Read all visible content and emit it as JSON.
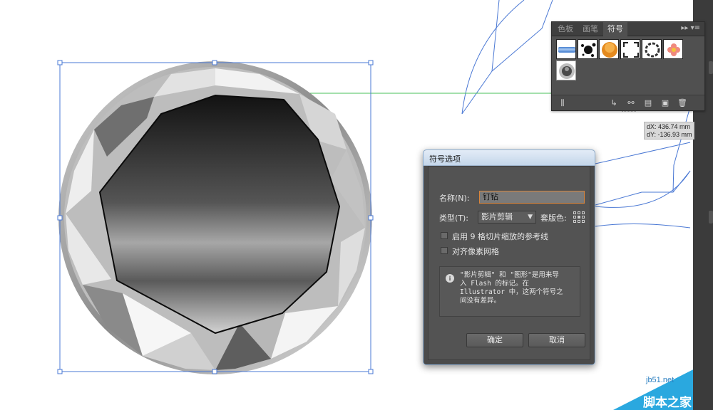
{
  "colors": {
    "selection_blue": "#4a78d4",
    "guide_green": "#49c25a",
    "panel_bg": "#505050",
    "dialog_bg": "#535353",
    "focus_orange": "#d9853b",
    "watermark_blue": "#2aa8df"
  },
  "panel": {
    "tabs": [
      "色板",
      "画笔",
      "符号"
    ],
    "active_tab": "符号",
    "symbols": [
      "blue-brush-stroke-symbol",
      "ink-splat-symbol",
      "orange-button-symbol",
      "frame-corners-symbol",
      "ring-symbol",
      "flower-symbol",
      "diamond-symbol"
    ],
    "footer_icons": [
      "symbol-libraries-icon",
      "place-symbol-icon",
      "break-link-icon",
      "symbol-options-icon",
      "new-symbol-icon",
      "delete-icon"
    ]
  },
  "coord": {
    "dx": "dX: 436.74 mm",
    "dy": "dY: -136.93 mm"
  },
  "dialog": {
    "title": "符号选项",
    "name_label": "名称(N):",
    "name_value": "钉钻",
    "type_label": "类型(T):",
    "type_value": "影片剪辑",
    "registration_label": "套版色:",
    "option_9slice": "启用 9 格切片缩放的参考线",
    "option_pixel": "对齐像素网格",
    "info_lines": [
      "\"影片剪辑\" 和 \"图形\"是用来导",
      "入 Flash 的标记。在",
      "Illustrator 中，这两个符号之",
      "间没有差异。"
    ],
    "ok_label": "确定",
    "cancel_label": "取消"
  },
  "watermark": {
    "site": "jb51.net",
    "name": "脚本之家"
  }
}
